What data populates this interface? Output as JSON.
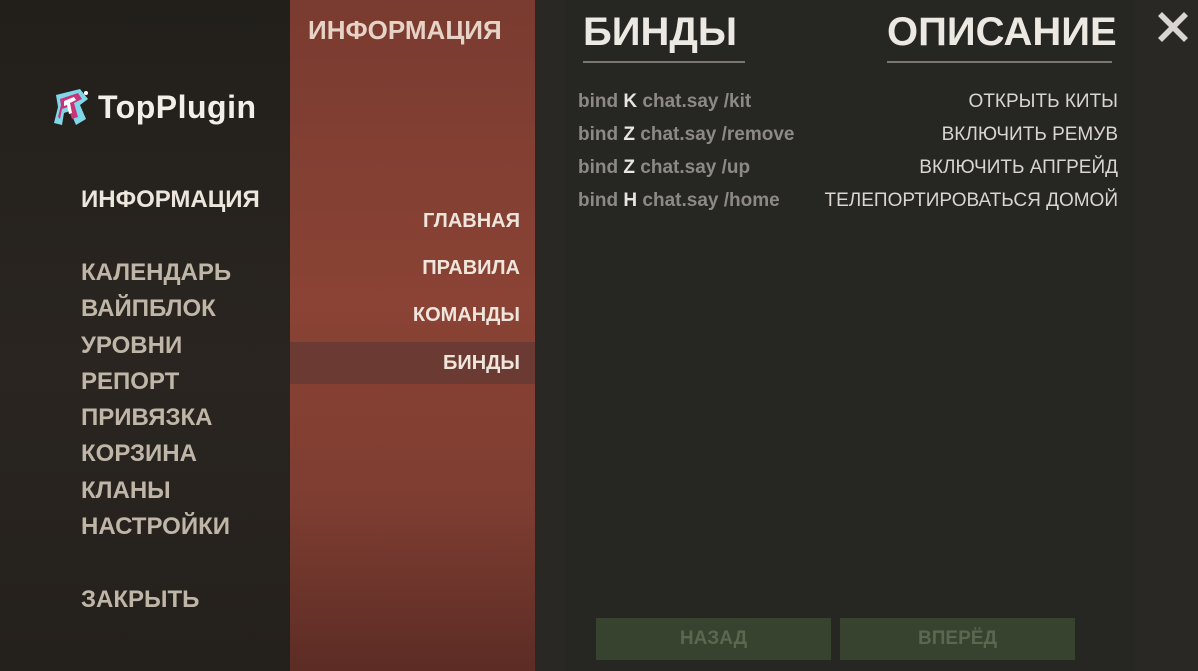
{
  "logo": {
    "text": "TopPlugin"
  },
  "nav": {
    "main": "ИНФОРМАЦИЯ",
    "items": [
      "КАЛЕНДАРЬ",
      "ВАЙПБЛОК",
      "УРОВНИ",
      "РЕПОРТ",
      "ПРИВЯЗКА",
      "КОРЗИНА",
      "КЛАНЫ",
      "НАСТРОЙКИ"
    ],
    "close": "ЗАКРЫТЬ"
  },
  "submenu": {
    "title": "ИНФОРМАЦИЯ",
    "items": [
      "ГЛАВНАЯ",
      "ПРАВИЛА",
      "КОМАНДЫ",
      "БИНДЫ"
    ],
    "active": "БИНДЫ"
  },
  "content": {
    "binds_header": "БИНДЫ",
    "description_header": "ОПИСАНИЕ",
    "rows": [
      {
        "prefix": "bind",
        "key": "K",
        "command": "chat.say /kit",
        "description": "ОТКРЫТЬ КИТЫ"
      },
      {
        "prefix": "bind",
        "key": "Z",
        "command": "chat.say /remove",
        "description": "ВКЛЮЧИТЬ РЕМУВ"
      },
      {
        "prefix": "bind",
        "key": "Z",
        "command": "chat.say /up",
        "description": "ВКЛЮЧИТЬ АПГРЕЙД"
      },
      {
        "prefix": "bind",
        "key": "H",
        "command": "chat.say /home",
        "description": "ТЕЛЕПОРТИРОВАТЬСЯ ДОМОЙ"
      }
    ]
  },
  "footer": {
    "back": "НАЗАД",
    "forward": "ВПЕРЁД"
  },
  "icons": {
    "close": "close-icon",
    "logo": "logo-icon"
  },
  "colors": {
    "panel_red": "#8a4335",
    "button_green": "#37422f",
    "background": "#27241f"
  }
}
